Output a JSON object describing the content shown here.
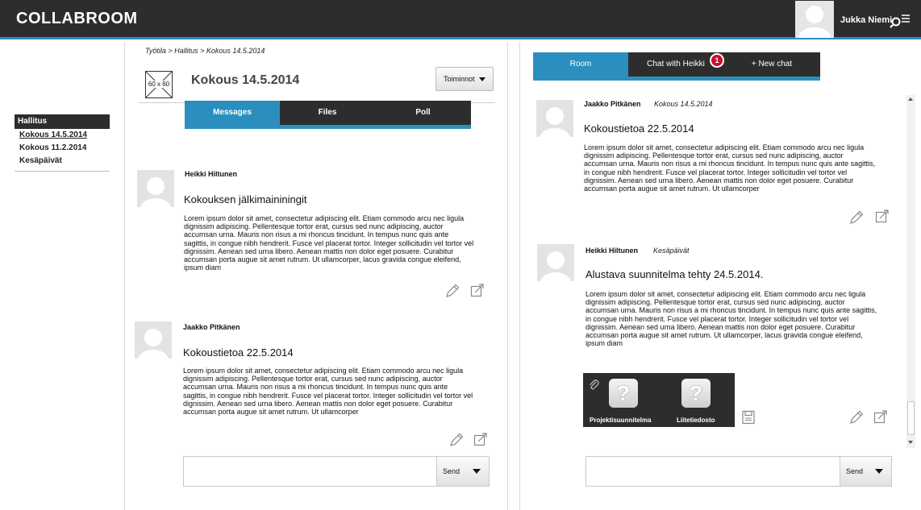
{
  "app": {
    "title": "COLLABROOM"
  },
  "user": {
    "name": "Jukka Niemi"
  },
  "colors": {
    "accent": "#2a8fbf",
    "dark": "#2d2d2d",
    "badge": "#c8102e"
  },
  "left_nav": {
    "header": "Hallitus",
    "items": [
      {
        "label": "Kokous 14.5.2014",
        "active": true
      },
      {
        "label": "Kokous 11.2.2014",
        "active": false
      },
      {
        "label": "Kesäpäivät",
        "active": false
      }
    ]
  },
  "main": {
    "breadcrumb": "Työtila > Hallitus > Kokous 14.5.2014",
    "thumbnail_label": "60 x 60",
    "title": "Kokous 14.5.2014",
    "actions_label": "Toiminnot",
    "tabs": [
      {
        "label": "Messages",
        "active": true
      },
      {
        "label": "Files",
        "active": false
      },
      {
        "label": "Poll",
        "active": false
      }
    ],
    "posts": [
      {
        "author": "Heikki Hiltunen",
        "title": "Kokouksen jälkimaininingit",
        "body": "Lorem ipsum dolor sit amet, consectetur adipiscing elit. Etiam commodo arcu nec ligula dignissim adipiscing. Pellentesque tortor erat, cursus sed nunc adipiscing, auctor accumsan urna. Mauris non risus a mi rhoncus tincidunt. In tempus nunc quis ante sagittis, in congue nibh hendrerit. Fusce vel placerat tortor. Integer sollicitudin vel tortor vel dignissim. Aenean sed urna libero. Aenean mattis non dolor eget posuere. Curabitur accumsan porta augue sit amet rutrum. Ut ullamcorper, lacus gravida congue eleifend, ipsum diam"
      },
      {
        "author": "Jaakko Pitkänen",
        "title": "Kokoustietoa 22.5.2014",
        "body": "Lorem ipsum dolor sit amet, consectetur adipiscing elit. Etiam commodo arcu nec ligula dignissim adipiscing. Pellentesque tortor erat, cursus sed nunc adipiscing, auctor accumsan urna. Mauris non risus a mi rhoncus tincidunt. In tempus nunc quis ante sagittis, in congue nibh hendrerit. Fusce vel placerat tortor. Integer sollicitudin vel tortor vel dignissim. Aenean sed urna libero. Aenean mattis non dolor eget posuere. Curabitur accumsan porta augue sit amet rutrum. Ut ullamcorper"
      }
    ],
    "send_label": "Send"
  },
  "chat": {
    "tabs": [
      {
        "label": "Room",
        "active": true
      },
      {
        "label": "Chat with Heikki",
        "badge": "1"
      },
      {
        "label": "+ New chat"
      }
    ],
    "posts": [
      {
        "author": "Jaakko Pitkänen",
        "context": "Kokous 14.5.2014",
        "title": "Kokoustietoa 22.5.2014",
        "body": "Lorem ipsum dolor sit amet, consectetur adipiscing elit. Etiam commodo arcu nec ligula dignissim adipiscing. Pellentesque tortor erat, cursus sed nunc adipiscing, auctor accumsan urna. Mauris non risus a mi rhoncus tincidunt. In tempus nunc quis ante sagittis, in congue nibh hendrerit. Fusce vel placerat tortor. Integer sollicitudin vel tortor vel dignissim. Aenean sed urna libero. Aenean mattis non dolor eget posuere. Curabitur accumsan porta augue sit amet rutrum. Ut ullamcorper"
      },
      {
        "author": "Heikki Hiltunen",
        "context": "Kesäpäivät",
        "title": "Alustava suunnitelma tehty 24.5.2014.",
        "body": "Lorem ipsum dolor sit amet, consectetur adipiscing elit. Etiam commodo arcu nec ligula dignissim adipiscing. Pellentesque tortor erat, cursus sed nunc adipiscing, auctor accumsan urna. Mauris non risus a mi rhoncus tincidunt. In tempus nunc quis ante sagittis, in congue nibh hendrerit. Fusce vel placerat tortor. Integer sollicitudin vel tortor vel dignissim. Aenean sed urna libero. Aenean mattis non dolor eget posuere. Curabitur accumsan porta augue sit amet rutrum. Ut ullamcorper, lacus gravida congue eleifend, ipsum diam",
        "attachments": [
          {
            "label": "Projektisuunnitelma",
            "icon": "question-mark"
          },
          {
            "label": "Liitetiedosto",
            "icon": "question-mark"
          }
        ]
      }
    ],
    "send_label": "Send"
  },
  "icons": {
    "menu": "search-menu-icon",
    "edit": "pencil-icon",
    "share": "share-icon",
    "attachment": "paperclip-icon",
    "save": "floppy-disk-icon",
    "caret": "caret-down-icon"
  }
}
